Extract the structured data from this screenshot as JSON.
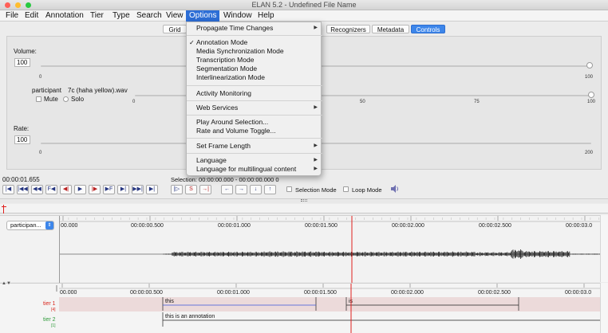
{
  "window": {
    "title": "ELAN 5.2 - Undefined File Name",
    "lights": [
      "#ff5f57",
      "#ffbd2e",
      "#28c940"
    ]
  },
  "menubar": {
    "items": [
      "File",
      "Edit",
      "Annotation",
      "Tier",
      "Type",
      "Search",
      "View",
      "Options",
      "Window",
      "Help"
    ],
    "active": "Options"
  },
  "tabs": {
    "grid": "Grid",
    "recognizers": "Recognizers",
    "metadata": "Metadata",
    "controls": "Controls",
    "selected": "Controls"
  },
  "controls": {
    "volume_label": "Volume:",
    "volume_value": "100",
    "volume_ticks": [
      "0",
      "100"
    ],
    "participant_label": "participant",
    "participant_file": "7c (haha yellow).wav",
    "mute_label": "Mute",
    "solo_label": "Solo",
    "participant_ticks": [
      "0",
      "50",
      "75",
      "100"
    ],
    "rate_label": "Rate:",
    "rate_value": "100",
    "rate_ticks": [
      "0",
      "200"
    ]
  },
  "media": {
    "current_time": "00:00:01.655",
    "selection": "Selection: 00:00:00.000 - 00:00:00.000  0",
    "selection_mode": "Selection Mode",
    "loop_mode": "Loop Mode",
    "buttons": [
      "|◀",
      "|◀◀",
      "◀◀",
      "F◀",
      "◀|",
      "▶",
      "|▶",
      "▶F",
      "▶|",
      "▶▶|",
      "▶|"
    ],
    "sel_buttons": [
      "|▷",
      "S",
      "→|"
    ],
    "nav_buttons": [
      "←",
      "→",
      "↓",
      "↑"
    ]
  },
  "wave": {
    "participant_select": "participan...",
    "time_ticks": [
      "00.000",
      "00:00:00.500",
      "00:00:01.000",
      "00:00:01.500",
      "00:00:02.000",
      "00:00:02.500",
      "00:00:03.0"
    ]
  },
  "tiers": {
    "time_ticks": [
      "00.000",
      "00:00:00.500",
      "00:00:01.000",
      "00:00:01.500",
      "00:00:02.000",
      "00:00:02.500",
      "00:00:03.0"
    ],
    "tier1_name": "tier 1",
    "tier1_count": "[4]",
    "tier2_name": "tier 2",
    "tier2_count": "[1]",
    "tier1_annotations": [
      "this",
      "is"
    ],
    "tier2_annotations": [
      "this is an annotation"
    ]
  },
  "options_menu": {
    "items": [
      {
        "label": "Propagate Time Changes",
        "submenu": true
      },
      {
        "label": "Annotation Mode",
        "checked": true
      },
      {
        "label": "Media Synchronization Mode"
      },
      {
        "label": "Transcription Mode"
      },
      {
        "label": "Segmentation Mode"
      },
      {
        "label": "Interlinearization Mode"
      },
      {
        "label": "Activity Monitoring"
      },
      {
        "label": "Web Services",
        "submenu": true
      },
      {
        "label": "Play Around Selection..."
      },
      {
        "label": "Rate and Volume Toggle..."
      },
      {
        "label": "Set Frame Length",
        "submenu": true
      },
      {
        "label": "Language",
        "submenu": true
      },
      {
        "label": "Language for multilingual content",
        "submenu": true
      }
    ],
    "check_glyph": "✓",
    "arrow_glyph": "▶"
  },
  "colors": {
    "accent": "#2d6ed6",
    "crosshair": "#e0201e",
    "tier1_name": "#d9261c",
    "tier2_name": "#2e9a3a",
    "selection_line": "#3a55d8"
  }
}
